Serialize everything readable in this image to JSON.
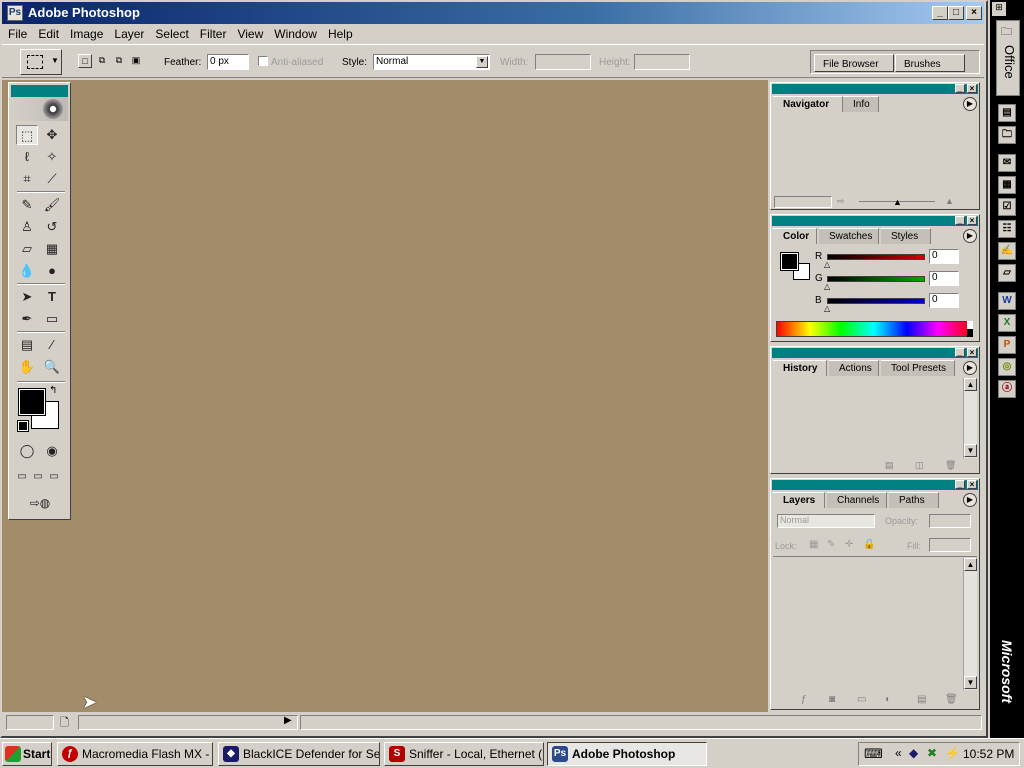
{
  "window": {
    "title": "Adobe Photoshop",
    "app_icon": "photoshop-eye-icon"
  },
  "menu": [
    "File",
    "Edit",
    "Image",
    "Layer",
    "Select",
    "Filter",
    "View",
    "Window",
    "Help"
  ],
  "options": {
    "feather_label": "Feather:",
    "feather_value": "0 px",
    "antialias_label": "Anti-aliased",
    "style_label": "Style:",
    "style_value": "Normal",
    "width_label": "Width:",
    "height_label": "Height:"
  },
  "palette_well": {
    "tabs": [
      "File Browser",
      "Brushes"
    ]
  },
  "navigator": {
    "tabs": [
      "Navigator",
      "Info"
    ]
  },
  "color": {
    "tabs": [
      "Color",
      "Swatches",
      "Styles"
    ],
    "channels": [
      {
        "label": "R",
        "value": "0",
        "color": "#cc0000"
      },
      {
        "label": "G",
        "value": "0",
        "color": "#00aa00"
      },
      {
        "label": "B",
        "value": "0",
        "color": "#0000cc"
      }
    ]
  },
  "history": {
    "tabs": [
      "History",
      "Actions",
      "Tool Presets"
    ]
  },
  "layers": {
    "tabs": [
      "Layers",
      "Channels",
      "Paths"
    ],
    "blend_mode": "Normal",
    "opacity_label": "Opacity:",
    "lock_label": "Lock:",
    "fill_label": "Fill:"
  },
  "office_bar": {
    "label": "Office",
    "brand": "Microsoft"
  },
  "taskbar": {
    "start_label": "Start",
    "tasks": [
      {
        "label": "Macromedia Flash MX - [...",
        "icon": "flash-icon",
        "color": "#c00000"
      },
      {
        "label": "BlackICE Defender for Se...",
        "icon": "blackice-icon",
        "color": "#1a1a6a"
      },
      {
        "label": "Sniffer - Local, Ethernet (L...",
        "icon": "sniffer-icon",
        "color": "#b00000"
      },
      {
        "label": "Adobe Photoshop",
        "icon": "photoshop-icon",
        "color": "#2a4a8a"
      }
    ],
    "clock": "10:52 PM"
  },
  "colors": {
    "canvas_bg": "#a38c6a",
    "panel_header": "#008080",
    "foreground": "#000000",
    "background": "#ffffff"
  }
}
